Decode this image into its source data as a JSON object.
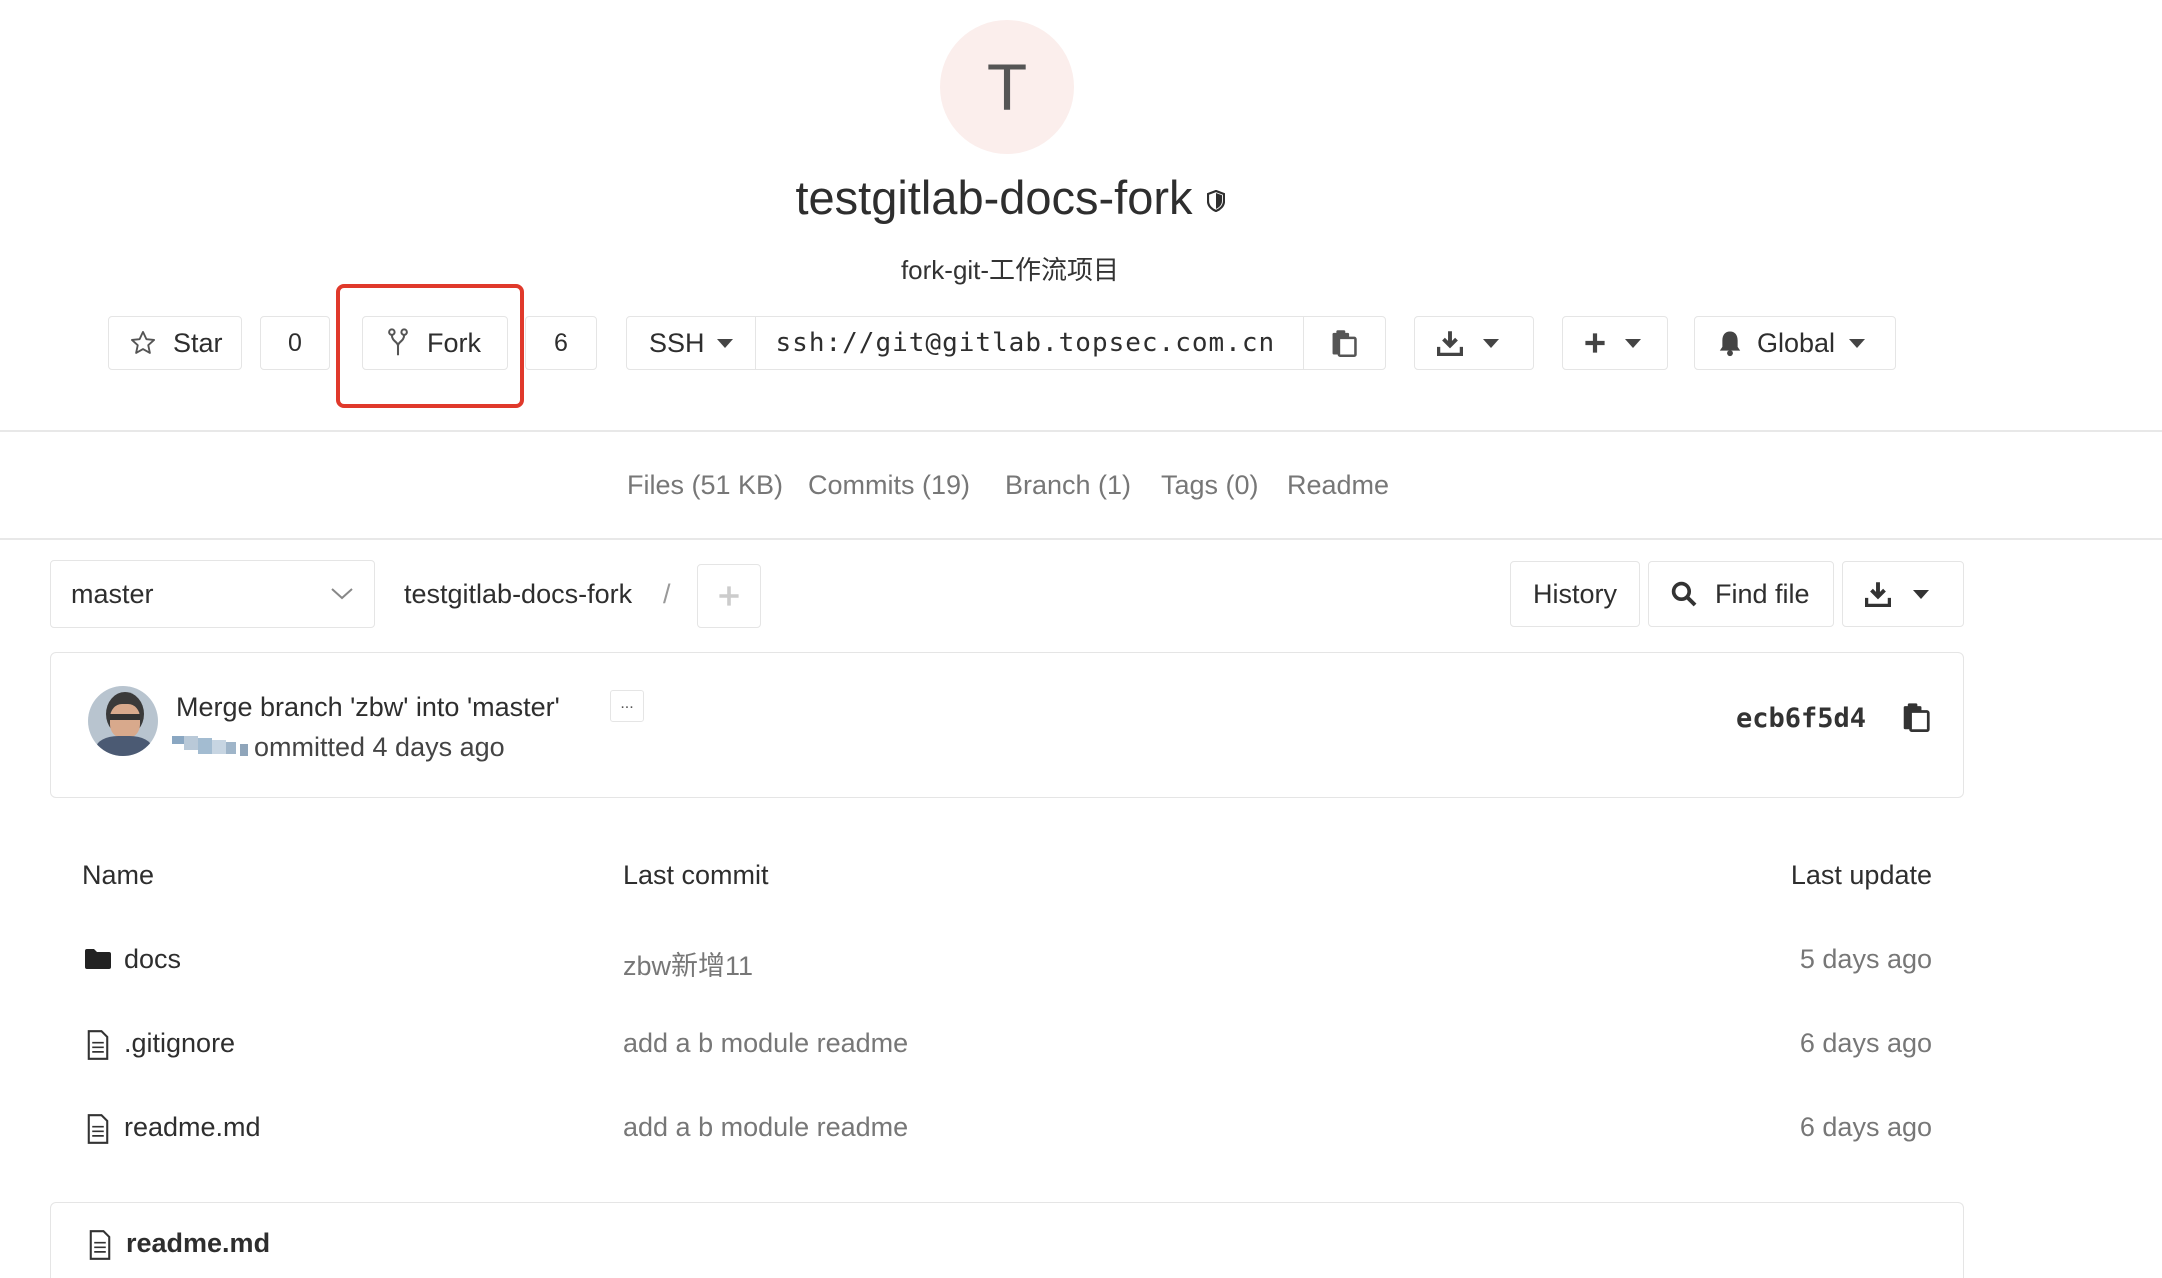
{
  "project": {
    "avatar_letter": "T",
    "name": "testgitlab-docs-fork",
    "description": "fork-git-工作流项目"
  },
  "actions": {
    "star_label": "Star",
    "star_count": "0",
    "fork_label": "Fork",
    "fork_count": "6",
    "protocol": "SSH",
    "clone_url": "ssh://git@gitlab.topsec.com.cn",
    "notification_label": "Global"
  },
  "nav": {
    "files": "Files (51 KB)",
    "commits": "Commits (19)",
    "branch": "Branch (1)",
    "tags": "Tags (0)",
    "readme": "Readme"
  },
  "tree": {
    "branch": "master",
    "path": "testgitlab-docs-fork",
    "path_sep": "/",
    "history_label": "History",
    "find_file_label": "Find file"
  },
  "last_commit": {
    "title": "Merge branch 'zbw' into 'master'",
    "ellipsis": "...",
    "meta": "ommitted 4 days ago",
    "sha": "ecb6f5d4"
  },
  "table": {
    "headers": {
      "name": "Name",
      "last_commit": "Last commit",
      "last_update": "Last update"
    },
    "rows": [
      {
        "name": "docs",
        "commit": "zbw新增11",
        "updated": "5 days ago"
      },
      {
        "name": ".gitignore",
        "commit": "add a b module readme",
        "updated": "6 days ago"
      },
      {
        "name": "readme.md",
        "commit": "add a b module readme",
        "updated": "6 days ago"
      }
    ]
  },
  "readme_panel": {
    "filename": "readme.md"
  },
  "colors": {
    "highlight": "#e0392b",
    "avatar_bg": "#fbeeec"
  }
}
